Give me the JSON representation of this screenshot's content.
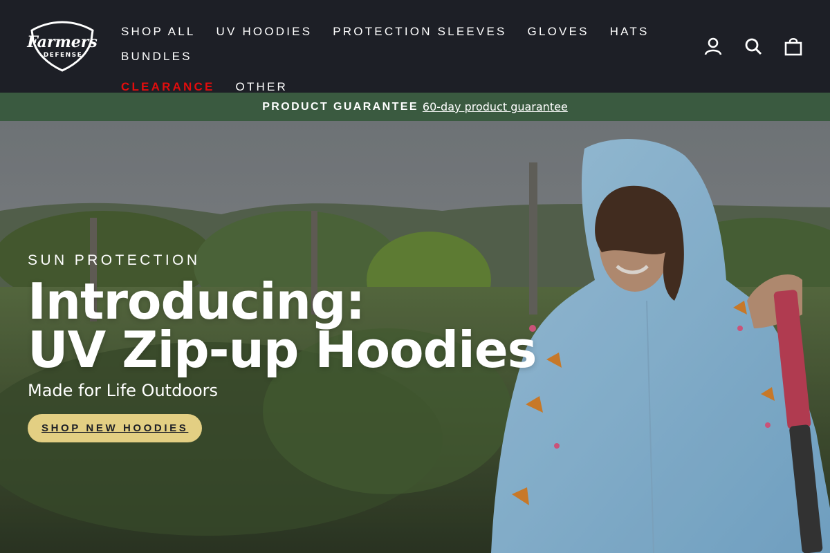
{
  "header": {
    "logo": {
      "text_top": "Farmers",
      "text_bottom": "DEFENSE",
      "icon": "shield-logo"
    },
    "nav": {
      "row1": [
        "SHOP ALL",
        "UV HOODIES",
        "PROTECTION SLEEVES",
        "GLOVES",
        "HATS",
        "BUNDLES"
      ],
      "row2": [
        "CLEARANCE",
        "OTHER"
      ],
      "highlight_color": "#e30d0d"
    },
    "icons": [
      "account-icon",
      "search-icon",
      "cart-icon"
    ]
  },
  "announcement": {
    "strong": "PRODUCT GUARANTEE",
    "link": "60-day product guarantee",
    "background": "#3a5a40"
  },
  "hero": {
    "eyebrow": "SUN PROTECTION",
    "headline_line1": "Introducing:",
    "headline_line2": "UV Zip-up Hoodies",
    "subline": "Made for Life Outdoors",
    "cta": "SHOP NEW HOODIES",
    "cta_color": "#e3cf83"
  }
}
